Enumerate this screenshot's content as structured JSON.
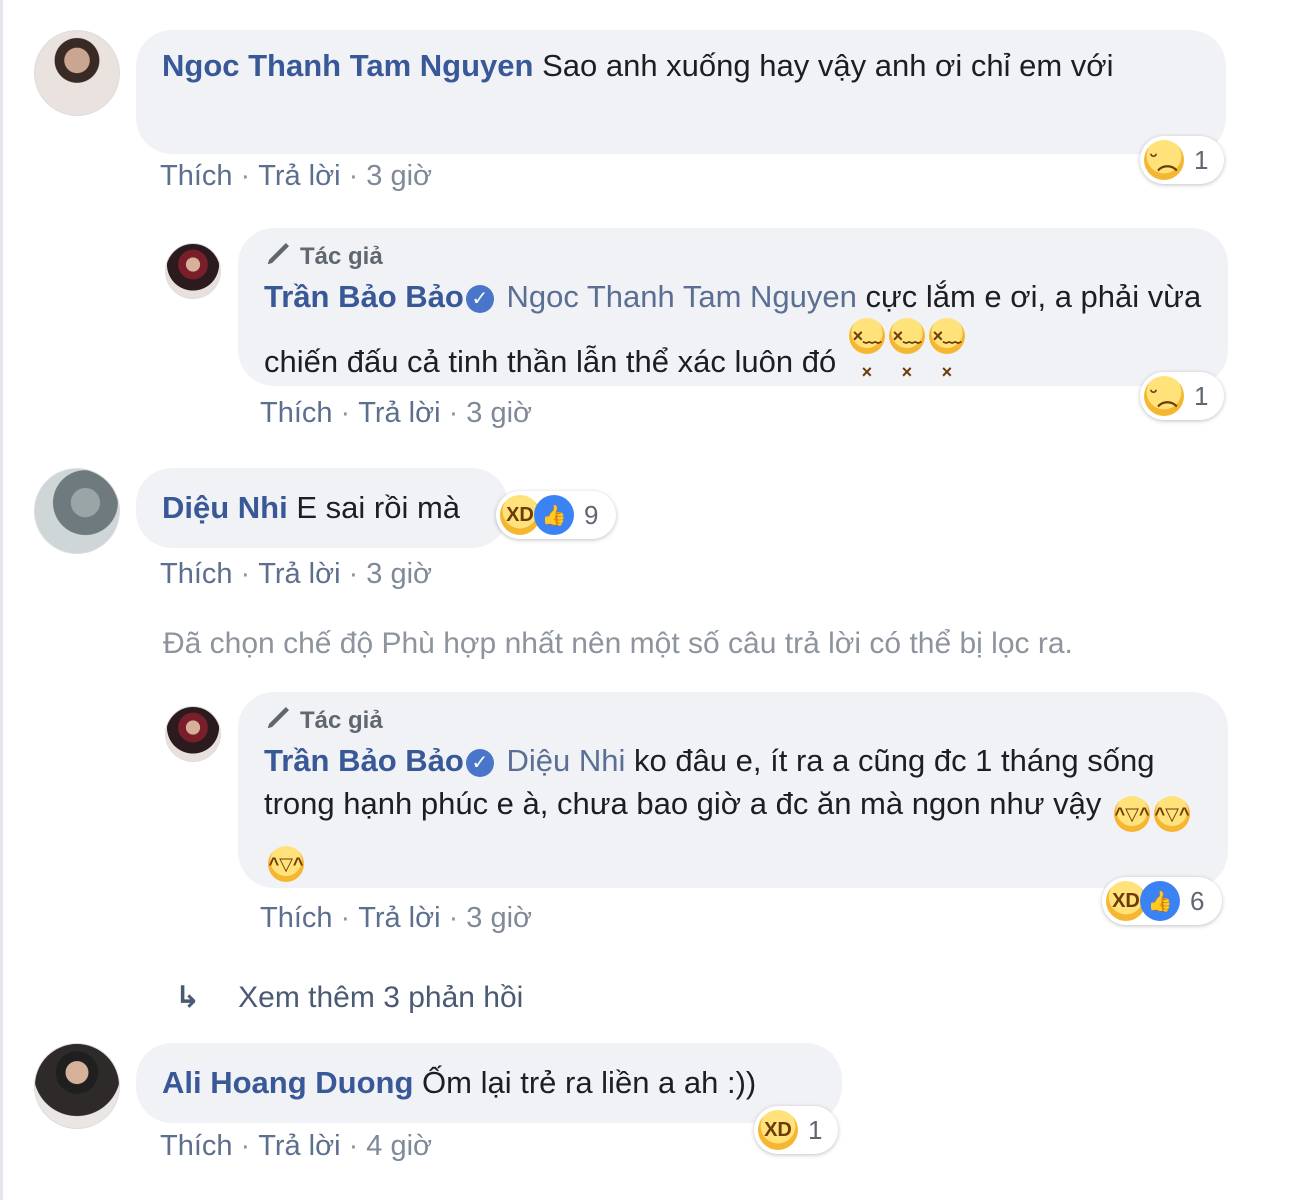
{
  "actions": {
    "like": "Thích",
    "reply": "Trả lời",
    "separator": "·"
  },
  "author_badge": "Tác giả",
  "comments": [
    {
      "author": "Ngoc Thanh Tam Nguyen",
      "text": "Sao anh xuống hay vậy anh ơi chỉ em với",
      "time": "3 giờ",
      "reaction_count": "1",
      "reactions": [
        "sad-face-icon"
      ]
    },
    {
      "author": "Trần Bảo Bảo",
      "mention": "Ngoc Thanh Tam Nguyen",
      "text": "cực lắm e ơi, a phải vừa chiến đấu cả tinh thần lẫn thể xác luôn đó",
      "time": "3 giờ",
      "reaction_count": "1",
      "reactions": [
        "sad-face-icon"
      ],
      "inline_emojis": [
        "tired-face-icon",
        "tired-face-icon",
        "tired-face-icon"
      ]
    },
    {
      "author": "Diệu Nhi",
      "text": "E sai rồi mà",
      "time": "3 giờ",
      "reaction_count": "9",
      "reactions": [
        "haha-face-icon",
        "like-icon"
      ]
    },
    {
      "author": "Trần Bảo Bảo",
      "mention": "Diệu Nhi",
      "text": "ko đâu e, ít ra a cũng đc 1 tháng sống trong hạnh phúc e à, chưa bao giờ a đc ăn mà ngon như vậy",
      "time": "3 giờ",
      "reaction_count": "6",
      "reactions": [
        "haha-face-icon",
        "like-icon"
      ],
      "inline_emojis": [
        "sweat-smile-icon",
        "sweat-smile-icon",
        "sweat-smile-icon"
      ]
    },
    {
      "author": "Ali Hoang Duong",
      "text": "Ốm lại trẻ ra liền a ah :))",
      "time": "4 giờ",
      "reaction_count": "1",
      "reactions": [
        "haha-face-icon"
      ]
    }
  ],
  "filter_notice": "Đã chọn chế độ Phù hợp nhất nên một số câu trả lời có thể bị lọc ra.",
  "view_more": "Xem thêm 3 phản hồi",
  "colors": {
    "name": "#385898",
    "bubble": "#f0f2f5",
    "meta": "#7f8a99",
    "like_blue": "#3b83f5"
  }
}
